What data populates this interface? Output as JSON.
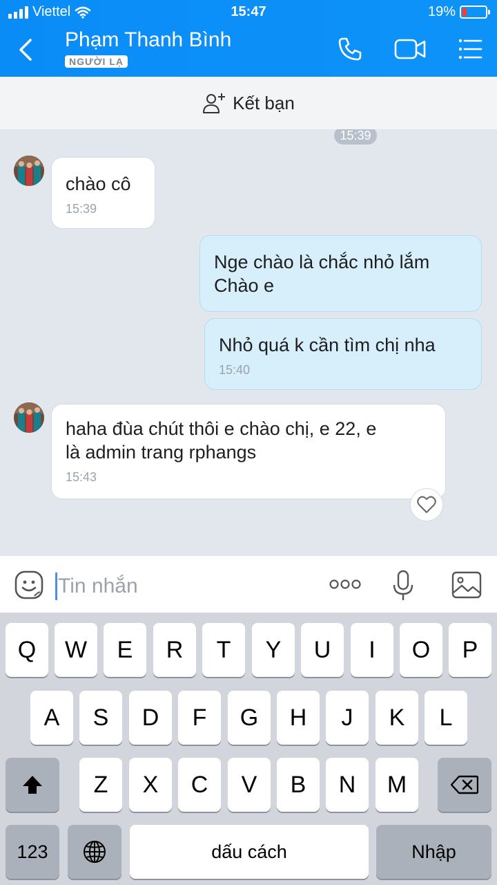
{
  "status_bar": {
    "carrier": "Viettel",
    "time": "15:47",
    "battery": "19%"
  },
  "header": {
    "contact_name": "Phạm Thanh Bình",
    "badge": "NGƯỜI LẠ",
    "icons": [
      "back-icon",
      "phone-icon",
      "video-call-icon",
      "menu-icon"
    ]
  },
  "add_friend": {
    "label": "Kết bạn"
  },
  "chat": {
    "top_time": "15:39",
    "messages": [
      {
        "direction": "in",
        "text": "chào cô",
        "time": "15:39"
      },
      {
        "direction": "out",
        "lines": [
          "Nge chào là chắc nhỏ lắm",
          "Chào e"
        ]
      },
      {
        "direction": "out",
        "text": "Nhỏ quá k cần tìm chị nha",
        "time": "15:40"
      },
      {
        "direction": "in",
        "lines": [
          "haha đùa chút thôi e chào chị, e 22, e",
          "là admin trang rphangs"
        ],
        "time": "15:43"
      }
    ]
  },
  "input": {
    "placeholder": "Tin nhắn",
    "value": ""
  },
  "keyboard": {
    "row1": [
      "Q",
      "W",
      "E",
      "R",
      "T",
      "Y",
      "U",
      "I",
      "O",
      "P"
    ],
    "row2": [
      "A",
      "S",
      "D",
      "F",
      "G",
      "H",
      "J",
      "K",
      "L"
    ],
    "row3": [
      "Z",
      "X",
      "C",
      "V",
      "B",
      "N",
      "M"
    ],
    "numbers_label": "123",
    "space_label": "dấu cách",
    "return_label": "Nhập"
  }
}
